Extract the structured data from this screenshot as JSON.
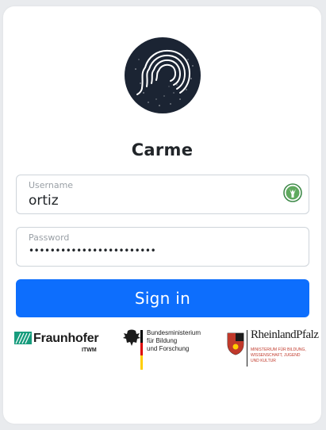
{
  "app": {
    "title": "Carme"
  },
  "login": {
    "username_label": "Username",
    "username_value": "ortiz",
    "password_label": "Password",
    "password_value": "••••••••••••••••••••••••",
    "signin_label": "Sign in"
  },
  "partners": {
    "fraunhofer": {
      "name": "Fraunhofer",
      "sub": "ITWM"
    },
    "bmbf": {
      "line1": "Bundesministerium",
      "line2": "für Bildung",
      "line3": "und Forschung"
    },
    "rlp": {
      "name": "RheinlandPfalz",
      "line1": "MINISTERIUM FÜR BILDUNG,",
      "line2": "WISSENSCHAFT, JUGEND",
      "line3": "UND KULTUR"
    }
  },
  "colors": {
    "primary": "#0d6efd",
    "logo_bg": "#1b2433",
    "fraunhofer_green": "#179c7d"
  },
  "icons": {
    "logo": "head-profile-logo",
    "password_manager": "password-manager-icon"
  }
}
